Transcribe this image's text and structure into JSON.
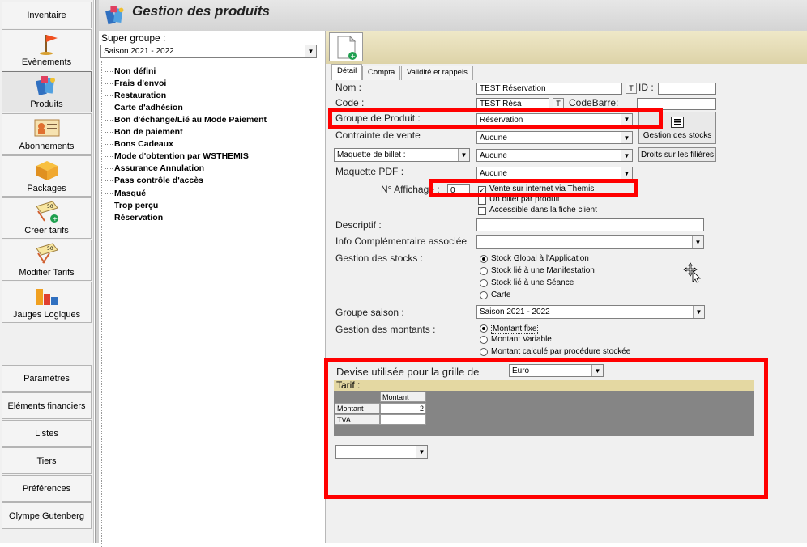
{
  "app": {
    "title": "Gestion des produits"
  },
  "nav": {
    "top": "Inventaire",
    "items": [
      "Evènements",
      "Produits",
      "Abonnements",
      "Packages",
      "Créer tarifs",
      "Modifier Tarifs",
      "Jauges Logiques"
    ],
    "bottom": [
      "Paramètres",
      "Eléments financiers",
      "Listes",
      "Tiers",
      "Préférences",
      "Olympe Gutenberg"
    ]
  },
  "groups": {
    "label": "Super groupe :",
    "selected": "Saison 2021 - 2022",
    "items": [
      "Non défini",
      "Frais d'envoi",
      "Restauration",
      "Carte d'adhésion",
      "Bon d'échange/Lié au Mode Paiement",
      "Bon de paiement",
      "Bons Cadeaux",
      "Mode d'obtention par WSTHEMIS",
      "Assurance Annulation",
      "Pass contrôle d'accès",
      "Masqué",
      "Trop perçu",
      "Réservation"
    ]
  },
  "tabs": [
    "Détail",
    "Compta",
    "Validité et rappels"
  ],
  "form": {
    "nom_label": "Nom :",
    "nom_value": "TEST Réservation",
    "t_button": "T",
    "id_label": "ID :",
    "id_value": "",
    "code_label": "Code :",
    "code_value": "TEST Résa",
    "codebarre_label": "CodeBarre:",
    "codebarre_value": "",
    "groupe_label": "Groupe de Produit :",
    "groupe_value": "Réservation",
    "contrainte_label": "Contrainte de vente",
    "contrainte_value": "Aucune",
    "maquette_billet_label": "Maquette de billet :",
    "maquette_billet_value": "Aucune",
    "maquette_pdf_label": "Maquette PDF :",
    "maquette_pdf_value": "Aucune",
    "affichage_label": "N° Affichage :",
    "affichage_value": "0",
    "gestion_stocks_button": "Gestion des stocks",
    "droits_button": "Droits sur les filières",
    "checkboxes": [
      {
        "label": "Vente sur internet via Themis",
        "checked": true
      },
      {
        "label": "Un billet par produit",
        "checked": false
      },
      {
        "label": "Accessible dans la fiche client",
        "checked": false
      }
    ],
    "descriptif_label": "Descriptif :",
    "descriptif_value": "",
    "info_label": "Info Complémentaire associée",
    "info_value": "",
    "stocks_label": "Gestion des stocks :",
    "stocks_options": [
      {
        "label": "Stock Global à l'Application",
        "selected": true
      },
      {
        "label": "Stock lié à une Manifestation",
        "selected": false
      },
      {
        "label": "Stock lié à une Séance",
        "selected": false
      },
      {
        "label": "Carte",
        "selected": false
      }
    ],
    "saison_label": "Groupe saison :",
    "saison_value": "Saison 2021 - 2022",
    "montants_label": "Gestion des montants :",
    "montants_options": [
      {
        "label": "Montant fixe",
        "selected": true
      },
      {
        "label": "Montant Variable",
        "selected": false
      },
      {
        "label": "Montant calculé par procédure stockée",
        "selected": false
      }
    ]
  },
  "tarif": {
    "devise_label": "Devise utilisée pour la grille de",
    "devise_value": "Euro",
    "title": "Tarif :",
    "col_header": "Montant",
    "rows": [
      {
        "label": "Montant",
        "value": "2"
      },
      {
        "label": "TVA",
        "value": ""
      }
    ],
    "bottom_select": ""
  },
  "colors": {
    "highlight": "#ff0000",
    "toolbar": "#e4d8a2",
    "grid": "#858585"
  }
}
